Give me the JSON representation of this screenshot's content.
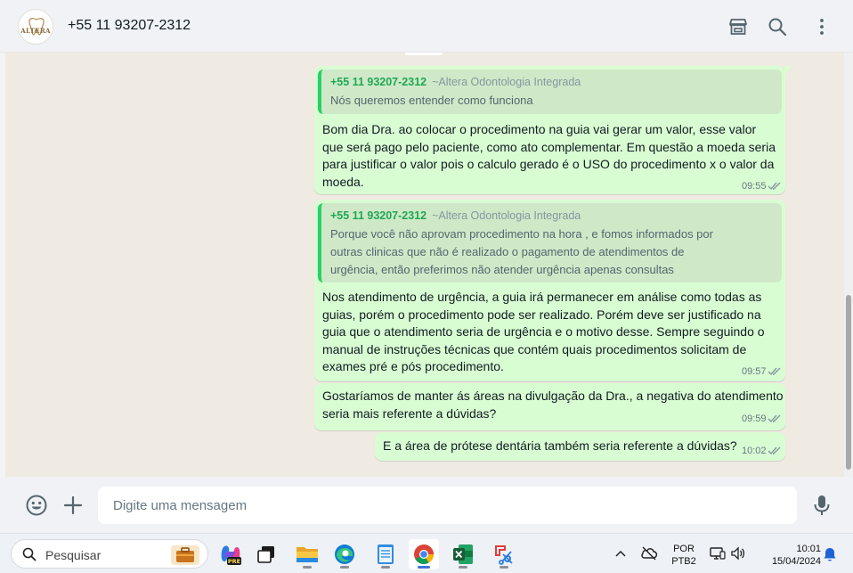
{
  "header": {
    "contact_name": "+55 11 93207-2312",
    "avatar_logo_text": "ALTERA",
    "icons": [
      "catalog-icon",
      "search-icon",
      "menu-icon"
    ]
  },
  "messages": [
    {
      "quote_author": "+55 11 93207-2312",
      "quote_sender": "~Altera Odontologia Integrada",
      "quote_lines": [
        "Nós queremos entender como funciona"
      ],
      "lines": [
        "Bom dia Dra. ao colocar o procedimento na guia vai gerar um valor, esse valor",
        "que será pago pelo paciente, como ato complementar. Em questão a moeda seria",
        "para justificar o valor pois o calculo gerado é o USO do procedimento x o valor da",
        "moeda."
      ],
      "time": "09:55"
    },
    {
      "quote_author": "+55 11 93207-2312",
      "quote_sender": "~Altera Odontologia Integrada",
      "quote_lines": [
        "Porque você não aprovam procedimento na hora , e fomos informados por",
        "outras clinicas que não é realizado o pagamento de atendimentos de",
        "urgência, então preferimos não atender urgência apenas consultas"
      ],
      "lines": [
        "Nos atendimento de urgência, a guia irá permanecer em análise como todas as",
        "guias, porém o procedimento pode ser realizado. Porém deve ser justificado na",
        "guia que o atendimento seria de urgência e o motivo desse. Sempre seguindo o",
        "manual de instruções técnicas que contém quais procedimentos solicitam de",
        "exames pré e pós procedimento."
      ],
      "time": "09:57"
    },
    {
      "lines": [
        "Gostaríamos de manter ás áreas na divulgação da Dra., a negativa do atendimento",
        "seria mais referente a dúvidas?"
      ],
      "time": "09:59"
    },
    {
      "lines": [
        "E a área de prótese dentária também seria referente a dúvidas?"
      ],
      "time": "10:02"
    }
  ],
  "composer": {
    "placeholder": "Digite uma mensagem",
    "icons": [
      "emoji-icon",
      "attach-plus-icon",
      "microphone-icon"
    ]
  },
  "taskbar": {
    "search_placeholder": "Pesquisar",
    "apps": [
      "work-briefcase-icon",
      "copilot-pre-icon",
      "task-view-icon",
      "file-explorer-icon",
      "edge-icon",
      "notepad-icon",
      "chrome-icon",
      "excel-icon",
      "snipping-tool-icon"
    ],
    "copilot_badge": "PRE",
    "language_line1": "POR",
    "language_line2": "PTB2",
    "clock_time": "10:01",
    "clock_date": "15/04/2024",
    "colors": {
      "accent_green": "#25d366",
      "bubble_green": "#d9fdd3",
      "quote_green": "#1fa855"
    }
  }
}
